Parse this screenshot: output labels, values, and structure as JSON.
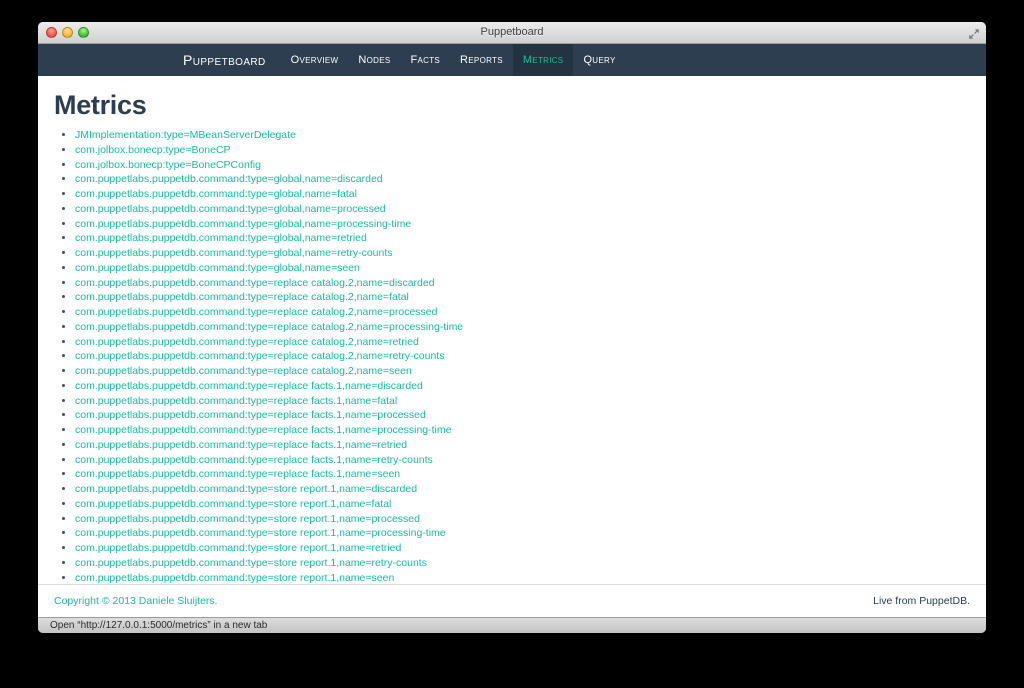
{
  "window": {
    "title": "Puppetboard",
    "status_bar": "Open “http://127.0.0.1:5000/metrics” in a new tab",
    "traffic_lights": [
      "close",
      "minimize",
      "zoom"
    ]
  },
  "navbar": {
    "brand": "Puppetboard",
    "items": [
      {
        "label": "Overview",
        "active": false
      },
      {
        "label": "Nodes",
        "active": false
      },
      {
        "label": "Facts",
        "active": false
      },
      {
        "label": "Reports",
        "active": false
      },
      {
        "label": "Metrics",
        "active": true
      },
      {
        "label": "Query",
        "active": false
      }
    ]
  },
  "page": {
    "title": "Metrics"
  },
  "metrics": {
    "items": [
      "JMImplementation:type=MBeanServerDelegate",
      "com.jolbox.bonecp:type=BoneCP",
      "com.jolbox.bonecp:type=BoneCPConfig",
      "com.puppetlabs.puppetdb.command:type=global,name=discarded",
      "com.puppetlabs.puppetdb.command:type=global,name=fatal",
      "com.puppetlabs.puppetdb.command:type=global,name=processed",
      "com.puppetlabs.puppetdb.command:type=global,name=processing-time",
      "com.puppetlabs.puppetdb.command:type=global,name=retried",
      "com.puppetlabs.puppetdb.command:type=global,name=retry-counts",
      "com.puppetlabs.puppetdb.command:type=global,name=seen",
      "com.puppetlabs.puppetdb.command:type=replace catalog.2,name=discarded",
      "com.puppetlabs.puppetdb.command:type=replace catalog.2,name=fatal",
      "com.puppetlabs.puppetdb.command:type=replace catalog.2,name=processed",
      "com.puppetlabs.puppetdb.command:type=replace catalog.2,name=processing-time",
      "com.puppetlabs.puppetdb.command:type=replace catalog.2,name=retried",
      "com.puppetlabs.puppetdb.command:type=replace catalog.2,name=retry-counts",
      "com.puppetlabs.puppetdb.command:type=replace catalog.2,name=seen",
      "com.puppetlabs.puppetdb.command:type=replace facts.1,name=discarded",
      "com.puppetlabs.puppetdb.command:type=replace facts.1,name=fatal",
      "com.puppetlabs.puppetdb.command:type=replace facts.1,name=processed",
      "com.puppetlabs.puppetdb.command:type=replace facts.1,name=processing-time",
      "com.puppetlabs.puppetdb.command:type=replace facts.1,name=retried",
      "com.puppetlabs.puppetdb.command:type=replace facts.1,name=retry-counts",
      "com.puppetlabs.puppetdb.command:type=replace facts.1,name=seen",
      "com.puppetlabs.puppetdb.command:type=store report.1,name=discarded",
      "com.puppetlabs.puppetdb.command:type=store report.1,name=fatal",
      "com.puppetlabs.puppetdb.command:type=store report.1,name=processed",
      "com.puppetlabs.puppetdb.command:type=store report.1,name=processing-time",
      "com.puppetlabs.puppetdb.command:type=store report.1,name=retried",
      "com.puppetlabs.puppetdb.command:type=store report.1,name=retry-counts",
      "com.puppetlabs.puppetdb.command:type=store report.1,name=seen"
    ]
  },
  "footer": {
    "copyright": "Copyright © 2013 Daniele Sluijters.",
    "right": "Live from PuppetDB."
  },
  "colors": {
    "accent": "#18bc9c",
    "navbar_bg": "#2c3e50",
    "navbar_active_bg": "#243342",
    "heading": "#2c3e50"
  }
}
